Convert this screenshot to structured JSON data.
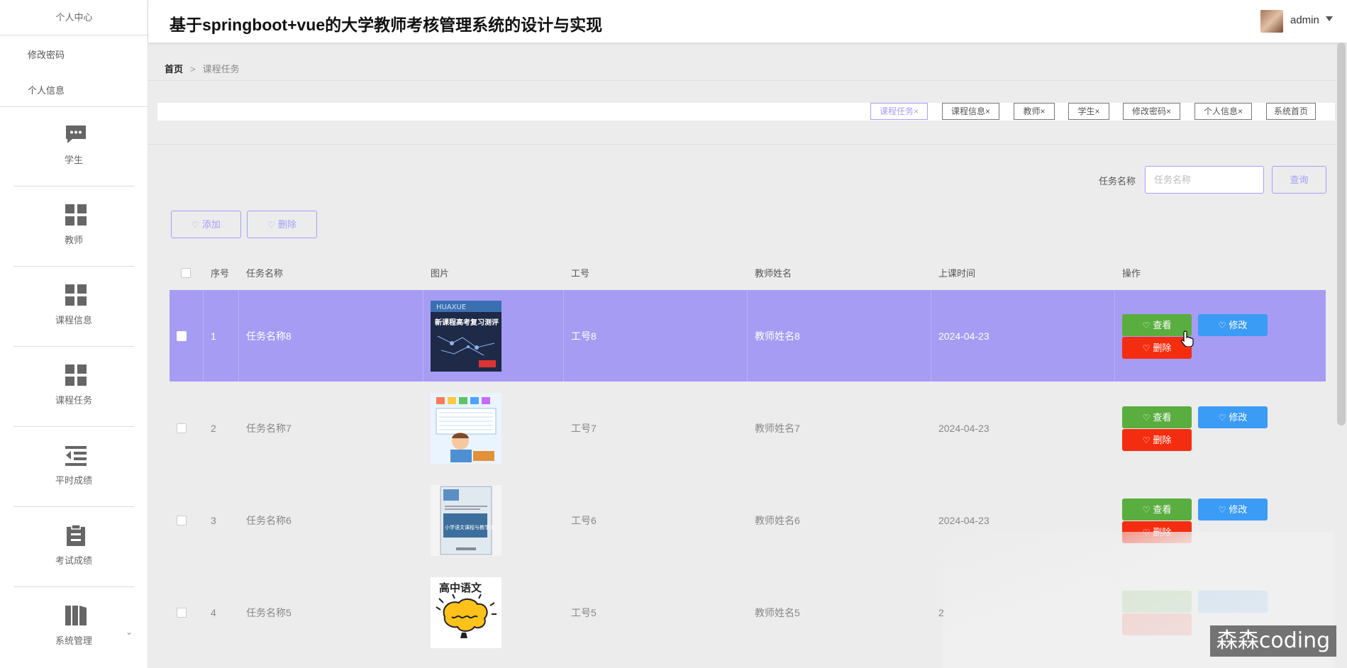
{
  "sidebar": {
    "top_label": "个人中心",
    "sub_items": [
      "修改密码",
      "个人信息"
    ],
    "items": [
      {
        "label": "学生",
        "icon": "chat-icon"
      },
      {
        "label": "教师",
        "icon": "grid-icon"
      },
      {
        "label": "课程信息",
        "icon": "grid-icon"
      },
      {
        "label": "课程任务",
        "icon": "grid-icon"
      },
      {
        "label": "平时成绩",
        "icon": "list-indent-icon"
      },
      {
        "label": "考试成绩",
        "icon": "clipboard-icon"
      },
      {
        "label": "系统管理",
        "icon": "book-icon"
      }
    ]
  },
  "header": {
    "title": "基于springboot+vue的大学教师考核管理系统的设计与实现",
    "user": "admin"
  },
  "breadcrumb": {
    "home": "首页",
    "separator": ">",
    "current": "课程任务"
  },
  "tags": [
    "课程任务",
    "课程信息",
    "教师",
    "学生",
    "修改密码",
    "个人信息",
    "系统首页"
  ],
  "tag_close": "×",
  "search": {
    "label": "任务名称",
    "placeholder": "任务名称",
    "button": "查询"
  },
  "actions": {
    "add": "添加",
    "delete": "删除"
  },
  "table": {
    "headers": [
      "序号",
      "任务名称",
      "图片",
      "工号",
      "教师姓名",
      "上课时间",
      "操作"
    ],
    "rows": [
      {
        "index": "1",
        "name": "任务名称8",
        "job_no": "工号8",
        "teacher": "教师姓名8",
        "time": "2024-04-23"
      },
      {
        "index": "2",
        "name": "任务名称7",
        "job_no": "工号7",
        "teacher": "教师姓名7",
        "time": "2024-04-23"
      },
      {
        "index": "3",
        "name": "任务名称6",
        "job_no": "工号6",
        "teacher": "教师姓名6",
        "time": "2024-04-23"
      },
      {
        "index": "4",
        "name": "任务名称5",
        "job_no": "工号5",
        "teacher": "教师姓名5",
        "time": "2"
      }
    ],
    "row_buttons": {
      "view": "查看",
      "edit": "修改",
      "delete": "删除"
    },
    "image_texts": {
      "img1_top": "HUAXUE",
      "img1_title": "新课程高考复习测评",
      "img3_title": "小学语文课程与教学论",
      "img4_title": "高中语文"
    }
  },
  "watermark": "森森coding",
  "colors": {
    "accent": "#a79ef7",
    "selected_row": "#a69cf4",
    "view": "#5aad3f",
    "edit": "#3b9cf5",
    "delete": "#f52d10"
  }
}
